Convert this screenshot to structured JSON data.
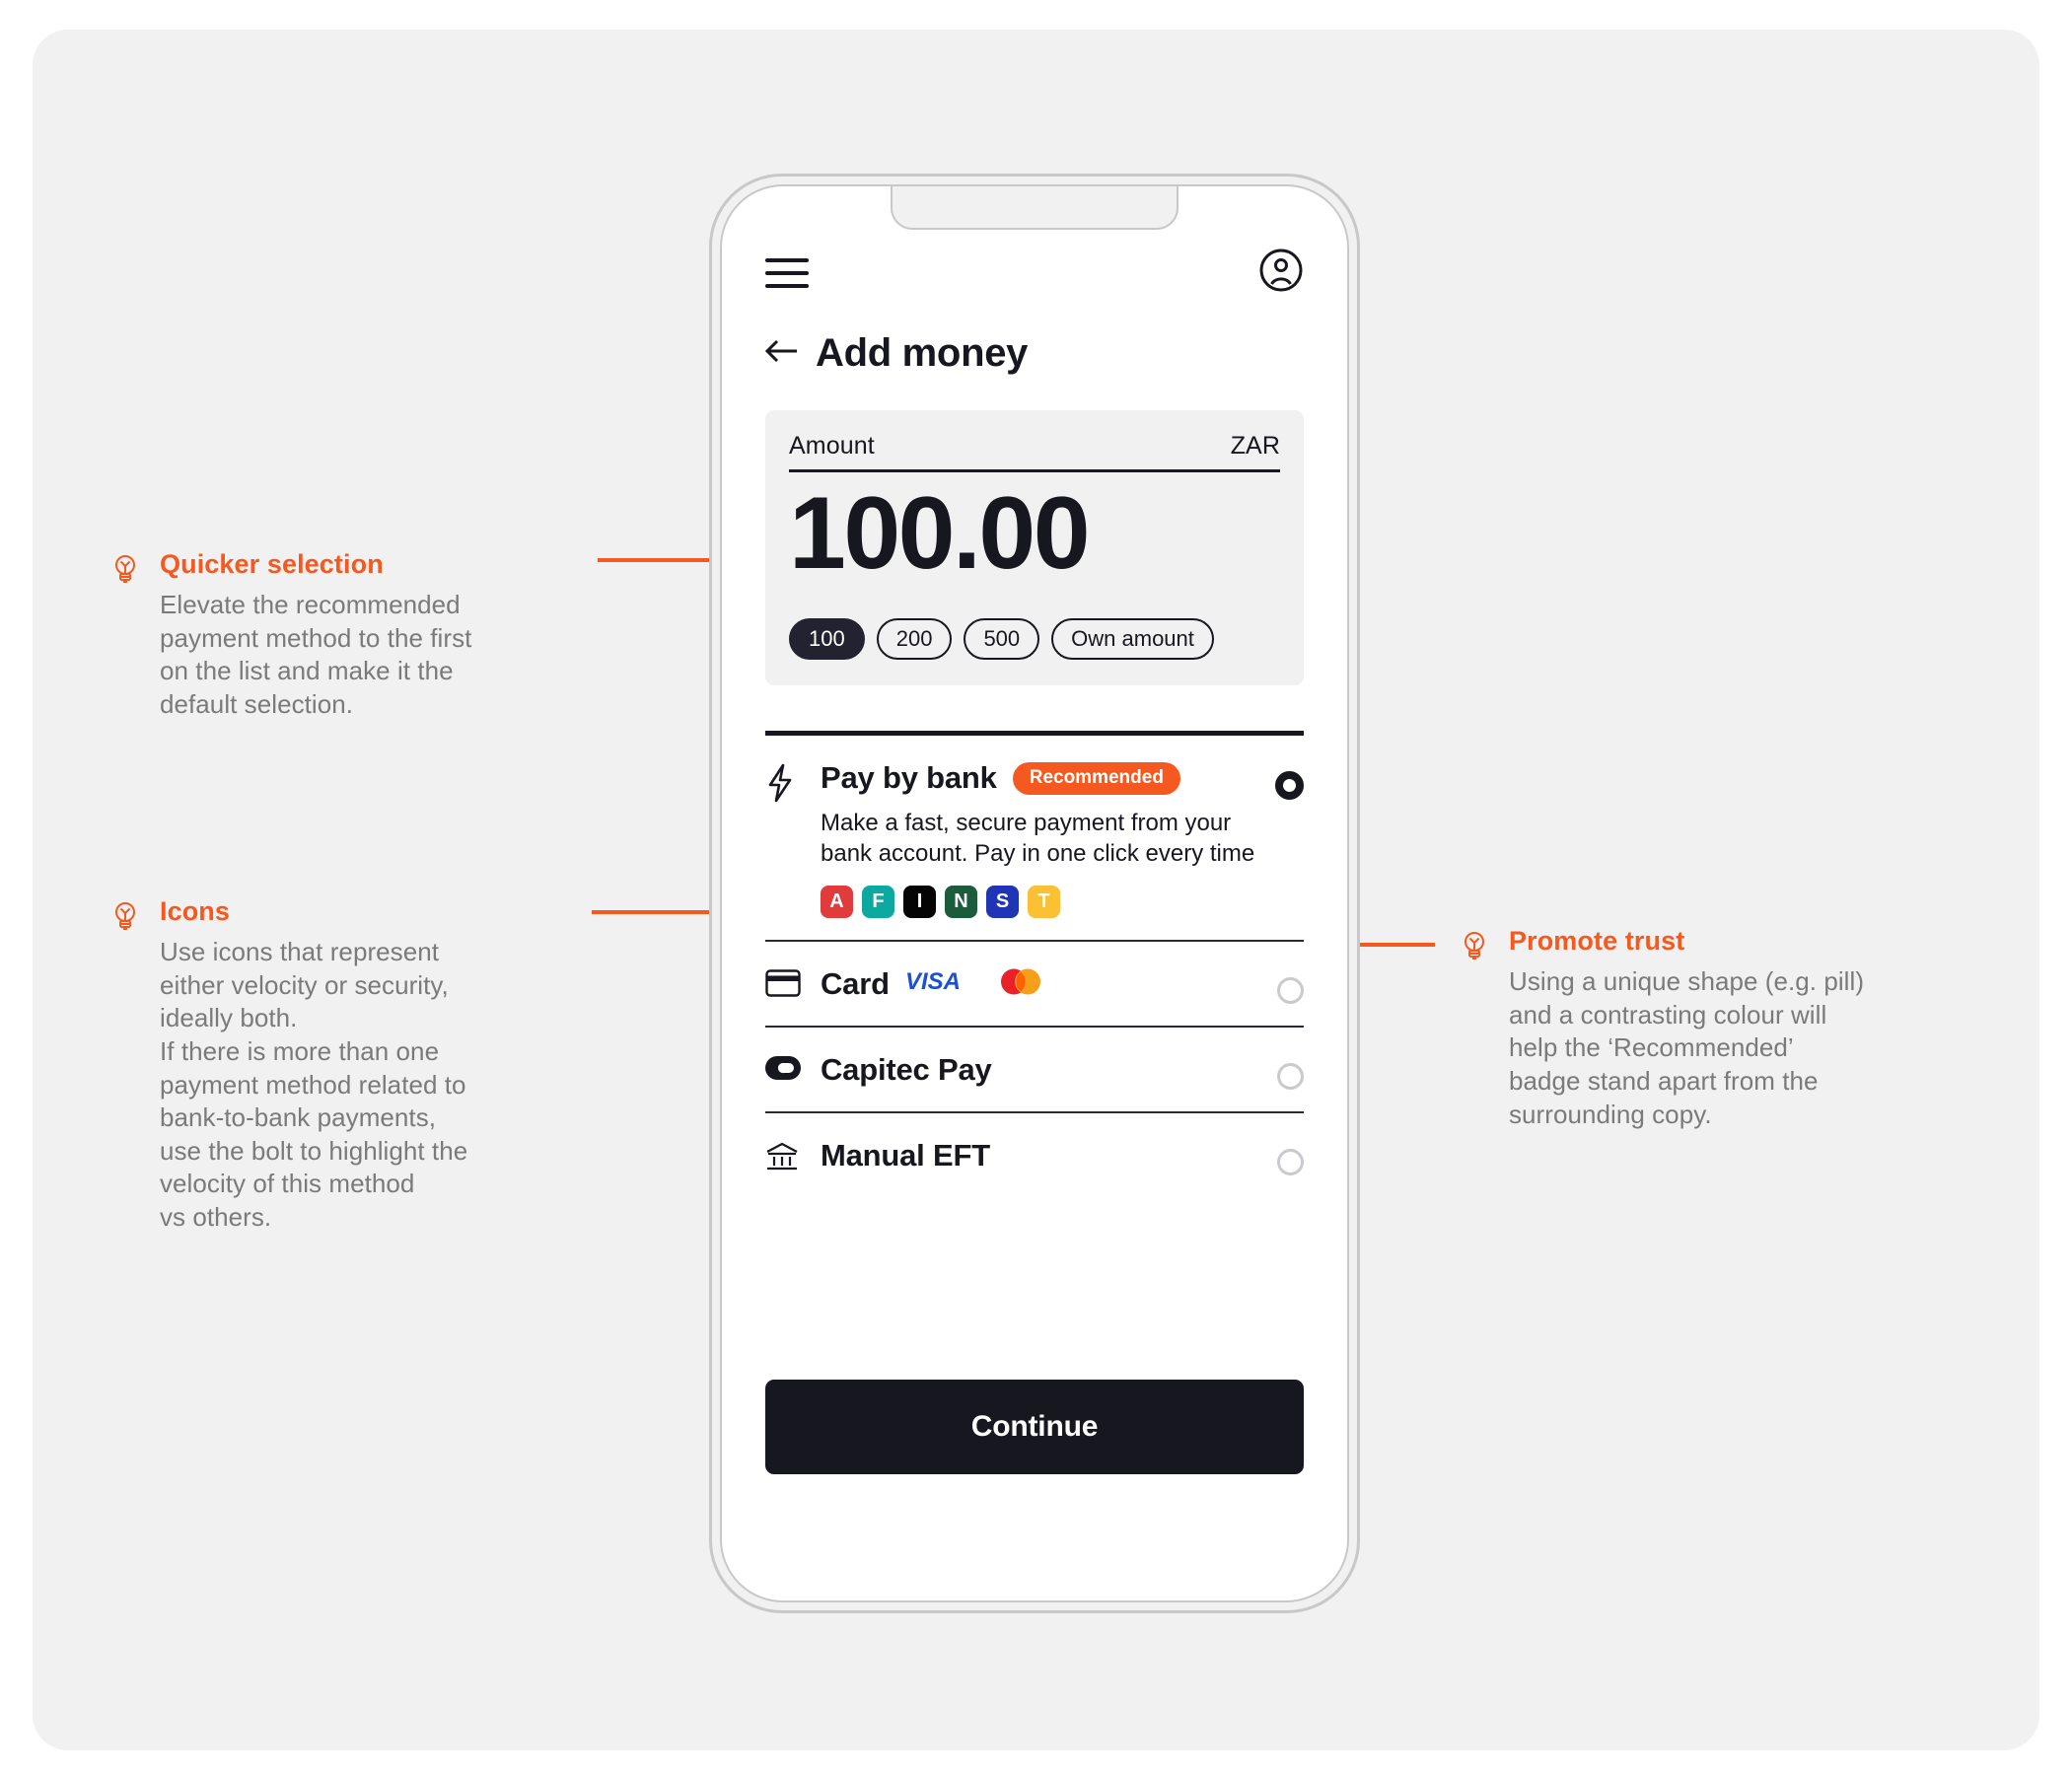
{
  "annotations": [
    {
      "id": "quicker",
      "icon": "lightbulb-icon",
      "title": "Quicker selection",
      "lines": [
        "Elevate the recommended",
        "payment method to the first",
        "on the list and make it the",
        "default selection."
      ]
    },
    {
      "id": "icons",
      "icon": "lightbulb-icon",
      "title": "Icons",
      "lines": [
        "Use icons that represent",
        "either velocity or security,",
        "ideally both.",
        "If there is more than one",
        "payment method related to",
        "bank-to-bank payments,",
        "use the bolt to highlight the",
        "velocity of this method",
        "vs others."
      ]
    },
    {
      "id": "trust",
      "icon": "lightbulb-icon",
      "title": "Promote trust",
      "lines": [
        "Using a unique shape (e.g. pill)",
        "and a contrasting colour will",
        "help the ‘Recommended’",
        "badge stand apart from the",
        "surrounding copy."
      ]
    }
  ],
  "phone": {
    "topbar": {
      "menu_icon": "hamburger-icon",
      "account_icon": "account-circle-icon"
    },
    "header": {
      "back_icon": "arrow-left-icon",
      "title": "Add money"
    },
    "amount_card": {
      "label": "Amount",
      "currency": "ZAR",
      "value": "100.00",
      "chips": [
        {
          "label": "100",
          "selected": true
        },
        {
          "label": "200",
          "selected": false
        },
        {
          "label": "500",
          "selected": false
        },
        {
          "label": "Own amount",
          "selected": false
        }
      ]
    },
    "methods": [
      {
        "icon": "bolt-icon",
        "title": "Pay by bank",
        "badge": "Recommended",
        "description": "Make a fast, secure payment from your bank account. Pay in one click every time",
        "selected": true,
        "bank_logos": [
          {
            "letter": "A",
            "color": "#e03c3c"
          },
          {
            "letter": "F",
            "color": "#0ca9a0"
          },
          {
            "letter": "I",
            "color": "#050505"
          },
          {
            "letter": "N",
            "color": "#1a5c3c"
          },
          {
            "letter": "S",
            "color": "#1f35b5"
          },
          {
            "letter": "T",
            "color": "#fcc034"
          }
        ]
      },
      {
        "icon": "credit-card-icon",
        "title": "Card",
        "badge": "",
        "description": "",
        "selected": false,
        "card_brands": [
          "VISA",
          "mastercard"
        ]
      },
      {
        "icon": "capitec-icon",
        "title": "Capitec Pay",
        "badge": "",
        "description": "",
        "selected": false
      },
      {
        "icon": "bank-icon",
        "title": "Manual EFT",
        "badge": "",
        "description": "",
        "selected": false
      }
    ],
    "continue_label": "Continue"
  },
  "colors": {
    "accent": "#f5591f",
    "ink": "#17171f",
    "muted": "#7a7a7a",
    "canvas": "#f1f1f1"
  }
}
